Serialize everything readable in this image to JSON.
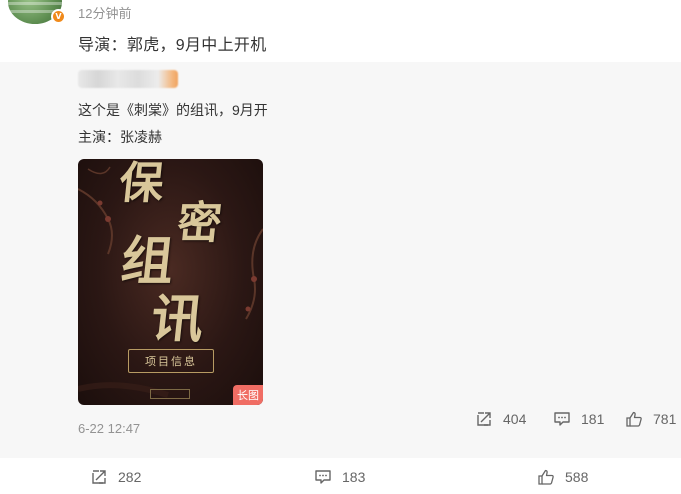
{
  "post": {
    "time": "12分钟前",
    "text": "导演：郭虎，9月中上开机"
  },
  "quote": {
    "line1": "这个是《刺棠》的组讯，9月开",
    "line2": "主演：张凌赫",
    "poster": {
      "chars": [
        "保",
        "密",
        "组",
        "讯"
      ],
      "frame_label": "项目信息",
      "long_image_badge": "长图"
    },
    "date": "6-22 12:47",
    "stats": {
      "reposts": "404",
      "comments": "181",
      "likes": "781"
    }
  },
  "footer": {
    "reposts": "282",
    "comments": "183",
    "likes": "588"
  },
  "colors": {
    "accent_badge": "#f08a1b",
    "long_image_badge": "#f06d64",
    "muted_text": "#939393",
    "quote_bg": "#f7f7f7"
  }
}
